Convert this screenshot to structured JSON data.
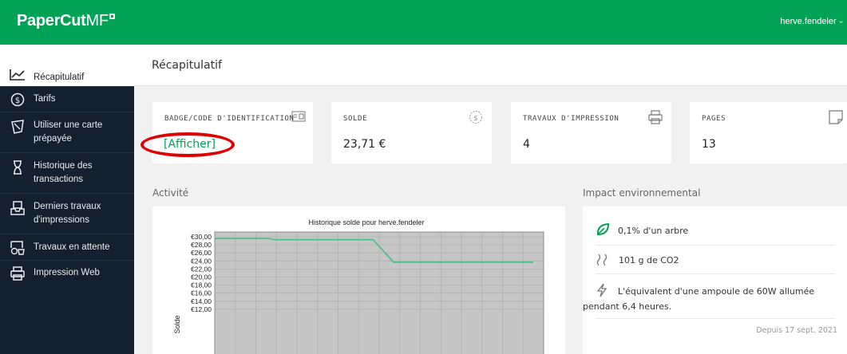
{
  "brand": {
    "name_main": "PaperCut",
    "name_suffix": "MF"
  },
  "header": {
    "user": "herve.fendeler"
  },
  "sidebar": {
    "items": [
      {
        "label": "Récapitulatif",
        "icon": "chart-line-icon",
        "active": true
      },
      {
        "label": "Tarifs",
        "icon": "dollar-circle-icon"
      },
      {
        "label": "Utiliser une carte prépayée",
        "icon": "tag-icon"
      },
      {
        "label": "Historique des transactions",
        "icon": "hourglass-icon"
      },
      {
        "label": "Derniers travaux d'impressions",
        "icon": "tray-icon"
      },
      {
        "label": "Travaux en attente",
        "icon": "pending-print-icon"
      },
      {
        "label": "Impression Web",
        "icon": "printer-icon"
      }
    ]
  },
  "page": {
    "title": "Récapitulatif"
  },
  "cards": [
    {
      "title": "BADGE/CODE D'IDENTIFICATION",
      "value": "[Afficher]",
      "icon": "id-card-icon"
    },
    {
      "title": "SOLDE",
      "value": "23,71 €",
      "icon": "dollar-circle-icon"
    },
    {
      "title": "TRAVAUX D'IMPRESSION",
      "value": "4",
      "icon": "printer-icon"
    },
    {
      "title": "PAGES",
      "value": "13",
      "icon": "page-icon"
    }
  ],
  "sections": {
    "activity": "Activité",
    "environment": "Impact environnemental"
  },
  "environment": {
    "tree": "0,1% d'un arbre",
    "co2": "101 g de CO2",
    "bulb": "L'équivalent d'une ampoule de 60W allumée pendant 6,4 heures.",
    "since": "Depuis 17 sept. 2021"
  },
  "colors": {
    "brand": "#00a356",
    "sidebar": "#15202e",
    "annotation": "#e00000",
    "line": "#3fbf84"
  },
  "chart_data": {
    "type": "line",
    "title": "Historique solde pour herve.fendeler",
    "ylabel": "Solde",
    "xlabel": "",
    "y_ticks": [
      "€30,00",
      "€28,00",
      "€26,00",
      "€24,00",
      "€22,00",
      "€20,00",
      "€18,00",
      "€16,00",
      "€14,00",
      "€12,00"
    ],
    "ylim_visible": [
      11.5,
      30
    ],
    "x": [
      0,
      1,
      2,
      3,
      4,
      5,
      6,
      7,
      8,
      9,
      10,
      11,
      12,
      13
    ],
    "series": [
      {
        "values": [
          29.6,
          29.6,
          29.6,
          29.3,
          29.3,
          29.3,
          29.3,
          23.71,
          23.71,
          23.71,
          23.71,
          23.71,
          23.71,
          23.71
        ]
      }
    ],
    "breakpoints": [
      {
        "x": 0,
        "y": 29.6
      },
      {
        "x": 2.6,
        "y": 29.6
      },
      {
        "x": 2.9,
        "y": 29.3
      },
      {
        "x": 7.7,
        "y": 29.3
      },
      {
        "x": 8.7,
        "y": 23.71
      },
      {
        "x": 15.5,
        "y": 23.71
      }
    ],
    "xlim": [
      0,
      16
    ],
    "grid": true
  }
}
